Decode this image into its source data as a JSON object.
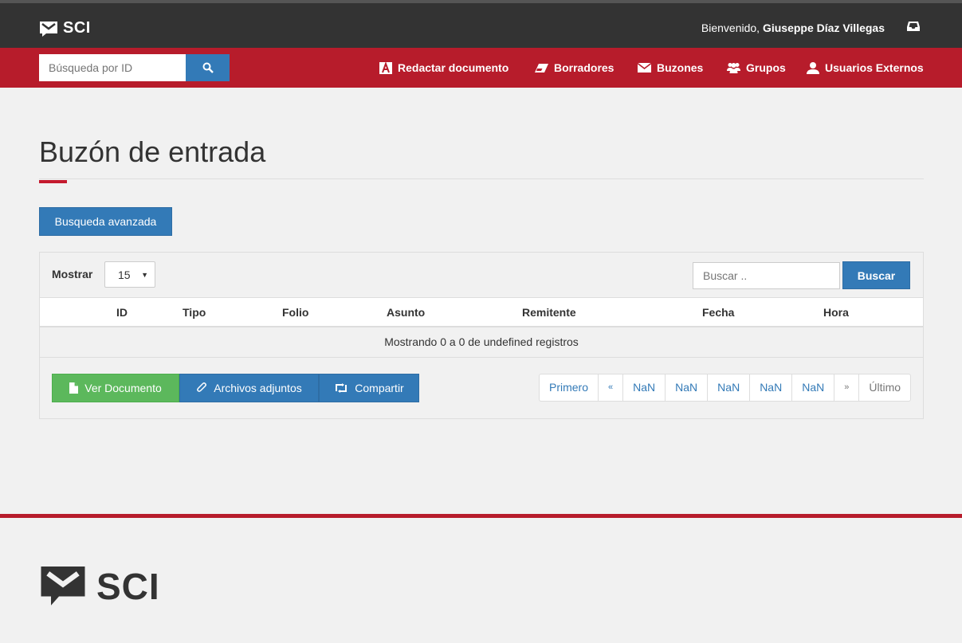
{
  "header": {
    "brand": "SCI",
    "welcome_prefix": "Bienvenido,",
    "user_name": "Giuseppe Díaz Villegas"
  },
  "navbar": {
    "search_placeholder": "Búsqueda por ID",
    "items": [
      {
        "label": "Redactar documento",
        "icon": "compose-icon"
      },
      {
        "label": "Borradores",
        "icon": "eraser-icon"
      },
      {
        "label": "Buzones",
        "icon": "envelope-icon"
      },
      {
        "label": "Grupos",
        "icon": "users-icon"
      },
      {
        "label": "Usuarios Externos",
        "icon": "user-icon"
      }
    ]
  },
  "main": {
    "title": "Buzón de entrada",
    "advanced_search_label": "Busqueda avanzada",
    "show_label": "Mostrar",
    "page_size": "15",
    "search_placeholder": "Buscar ..",
    "search_button": "Buscar",
    "table": {
      "columns": [
        "ID",
        "Tipo",
        "Folio",
        "Asunto",
        "Remitente",
        "Fecha",
        "Hora"
      ],
      "empty_message": "Mostrando 0 a 0 de undefined registros"
    },
    "actions": {
      "view": "Ver Documento",
      "attachments": "Archivos adjuntos",
      "share": "Compartir"
    },
    "pagination": [
      "Primero",
      "«",
      "NaN",
      "NaN",
      "NaN",
      "NaN",
      "NaN",
      "»",
      "Último"
    ]
  },
  "footer": {
    "brand": "SCI"
  },
  "colors": {
    "topbar": "#333333",
    "navbar": "#b71c2b",
    "primary": "#337ab7",
    "success": "#5cb85c"
  }
}
